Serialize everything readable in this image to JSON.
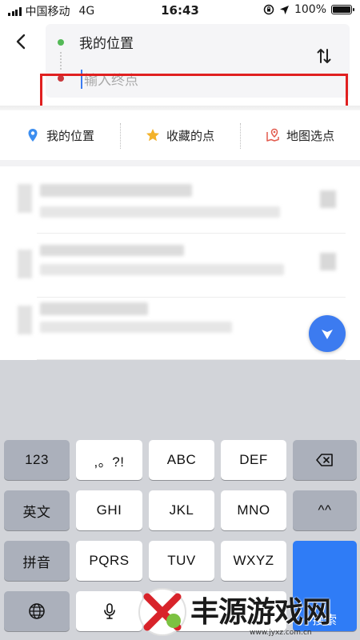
{
  "status_bar": {
    "carrier": "中国移动",
    "network": "4G",
    "time": "16:43",
    "battery": "100%"
  },
  "route": {
    "start_label": "我的位置",
    "end_placeholder": "输入终点",
    "end_value": ""
  },
  "quick_options": [
    {
      "label": "我的位置",
      "icon": "location-pin-icon"
    },
    {
      "label": "收藏的点",
      "icon": "star-icon"
    },
    {
      "label": "地图选点",
      "icon": "map-pick-icon"
    }
  ],
  "keyboard": {
    "row1": [
      "123",
      ",。?!",
      "ABC",
      "DEF"
    ],
    "row2": [
      "英文",
      "GHI",
      "JKL",
      "MNO",
      "^^"
    ],
    "row3": [
      "拼音",
      "PQRS",
      "TUV",
      "WXYZ"
    ],
    "search_label": "搜索",
    "delete_icon": "backspace-icon",
    "globe_icon": "globe-icon",
    "mic_icon": "microphone-icon"
  },
  "watermark": {
    "text": "丰源游戏网",
    "url": "www.jyxz.com.cn"
  },
  "colors": {
    "start_dot": "#54b957",
    "end_dot": "#c9393d",
    "highlight": "#e02020",
    "accent": "#2f7cf6"
  }
}
